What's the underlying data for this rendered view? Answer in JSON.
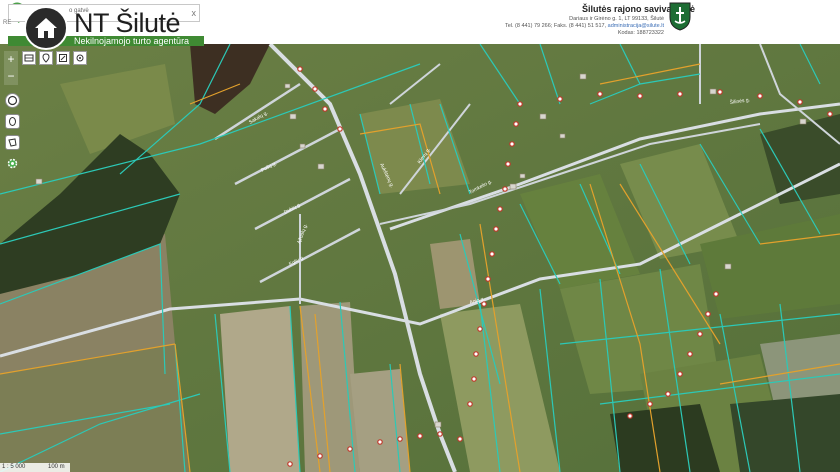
{
  "header": {
    "brand_title": "NT Šilutė",
    "brand_subtitle": "Nekilnojamojo turto agentūra",
    "search_hint": "o gatvė",
    "search_left": "RE",
    "close_glyph": "x",
    "home_icon": "home-icon",
    "municipality": {
      "name": "Šilutės rajono savivaldybė",
      "address": "Dariaus ir Girėno g. 1, LT 99133, Šilutė",
      "phone_prefix": "Tel. (8 441) 79 266; Faks. (8 441) 51 517,",
      "email": "administracija@silute.lt",
      "code": "Kodas: 188723322",
      "crest_icon": "coat-of-arms-icon"
    }
  },
  "toolbar": {
    "icons": [
      "layers-icon",
      "location-pin-icon",
      "edit-icon",
      "crosshair-icon"
    ],
    "zoom_in": "+",
    "zoom_out": "−"
  },
  "side_tools": [
    "circle-tool-icon",
    "ellipse-tool-icon",
    "polygon-tool-icon",
    "settings-icon"
  ],
  "scale": {
    "label": "1 : 5 000",
    "distance": "100 m"
  },
  "map": {
    "street_labels": [
      "Sakalų g.",
      "Pušų g.",
      "Dubių g.",
      "Eglių g.",
      "Ąžuolų g.",
      "Aukštėnų g.",
      "Klevų g.",
      "Tomkelio g.",
      "Anio g.",
      "Šilinės g."
    ],
    "colors": {
      "parcel_line": "#2cc9b7",
      "boundary_line": "#e3a12c",
      "road": "#d9dee3",
      "marker": "#ffffff",
      "marker_border": "#c0392b",
      "brand_green": "#3f8a33"
    }
  }
}
